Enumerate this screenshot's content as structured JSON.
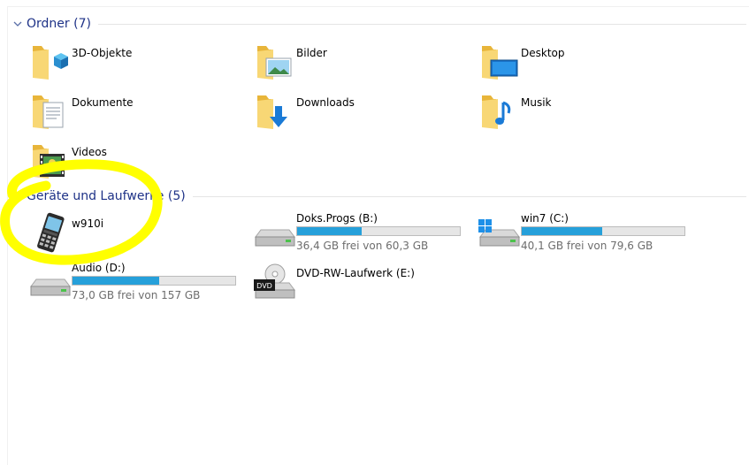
{
  "folders_group": {
    "title": "Ordner (7)",
    "items": [
      {
        "label": "3D-Objekte",
        "icon": "folder-3d-objects-icon"
      },
      {
        "label": "Bilder",
        "icon": "folder-pictures-icon"
      },
      {
        "label": "Desktop",
        "icon": "folder-desktop-icon"
      },
      {
        "label": "Dokumente",
        "icon": "folder-documents-icon"
      },
      {
        "label": "Downloads",
        "icon": "folder-downloads-icon"
      },
      {
        "label": "Musik",
        "icon": "folder-music-icon"
      },
      {
        "label": "Videos",
        "icon": "folder-videos-icon"
      }
    ]
  },
  "devices_group": {
    "title": "Geräte und Laufwerke (5)",
    "devices": [
      {
        "label": "w910i",
        "icon": "mobile-phone-icon"
      },
      {
        "label": "Doks.Progs (B:)",
        "free": "36,4 GB frei von 60,3 GB",
        "used_fraction": 0.396,
        "icon": "hard-drive-icon"
      },
      {
        "label": "win7 (C:)",
        "free": "40,1 GB frei von 79,6 GB",
        "used_fraction": 0.496,
        "icon": "windows-drive-icon"
      },
      {
        "label": "Audio (D:)",
        "free": "73,0 GB frei von 157 GB",
        "used_fraction": 0.535,
        "icon": "hard-drive-icon"
      },
      {
        "label": "DVD-RW-Laufwerk (E:)",
        "icon": "dvd-drive-icon",
        "badge": "DVD"
      }
    ]
  },
  "colors": {
    "group_title": "#1e3287",
    "bar_fill": "#26a0da",
    "bar_track": "#e6e6e6",
    "free_text": "#6d6d6d",
    "highlight": "#ffff00",
    "folder": "#f5c94f"
  }
}
